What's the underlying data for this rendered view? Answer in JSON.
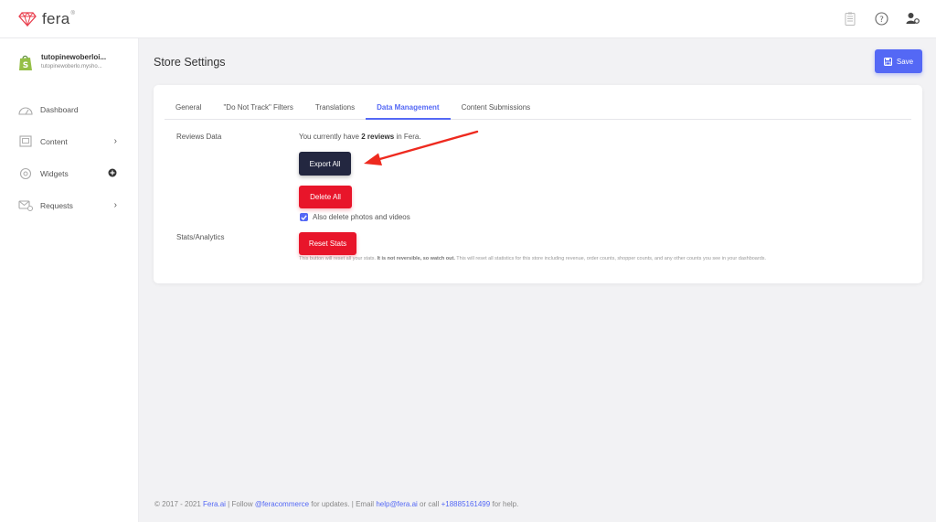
{
  "app": {
    "logo_text": "fera",
    "logo_sup": "®"
  },
  "topbar": {
    "icons": [
      "clipboard-icon",
      "help-icon",
      "user-settings-icon"
    ]
  },
  "sidebar": {
    "store": {
      "name": "tutopinewoberloi...",
      "domain": "tutopinewoberlo.mysho..."
    },
    "items": [
      {
        "label": "Dashboard",
        "icon": "dashboard-icon",
        "right": ""
      },
      {
        "label": "Content",
        "icon": "content-icon",
        "right": "›"
      },
      {
        "label": "Widgets",
        "icon": "widgets-icon",
        "right": "plus-circle"
      },
      {
        "label": "Requests",
        "icon": "requests-icon",
        "right": "›"
      }
    ]
  },
  "page": {
    "title": "Store Settings",
    "save_label": "Save"
  },
  "tabs": [
    {
      "label": "General",
      "active": false
    },
    {
      "label": "\"Do Not Track\" Filters",
      "active": false
    },
    {
      "label": "Translations",
      "active": false
    },
    {
      "label": "Data Management",
      "active": true
    },
    {
      "label": "Content Submissions",
      "active": false
    }
  ],
  "data_management": {
    "reviews_label": "Reviews Data",
    "reviews_prefix": "You currently have ",
    "reviews_count": "2 reviews",
    "reviews_suffix": " in Fera.",
    "export_label": "Export All",
    "delete_label": "Delete All",
    "delete_media_label": "Also delete photos and videos",
    "delete_media_checked": true,
    "stats_label": "Stats/Analytics",
    "reset_label": "Reset Stats",
    "hint_prefix": "This button will reset all your stats. ",
    "hint_bold": "It is not reversible, so watch out.",
    "hint_suffix": " This will reset all statistics for this store including revenue, order counts, shopper counts, and any other counts you see in your dashboards."
  },
  "footer": {
    "text1": "© 2017 - 2021 ",
    "link1": "Fera.ai",
    "text2": "  |  Follow ",
    "link2": "@feracommerce",
    "text3": " for updates.  |  Email ",
    "link3": "help@fera.ai",
    "text4": " or call ",
    "link4": "+18885161499",
    "text5": " for help."
  },
  "colors": {
    "accent": "#5468f5",
    "danger": "#e8152a",
    "dark_button": "#232740",
    "annotation_arrow": "#ee2a1f"
  }
}
